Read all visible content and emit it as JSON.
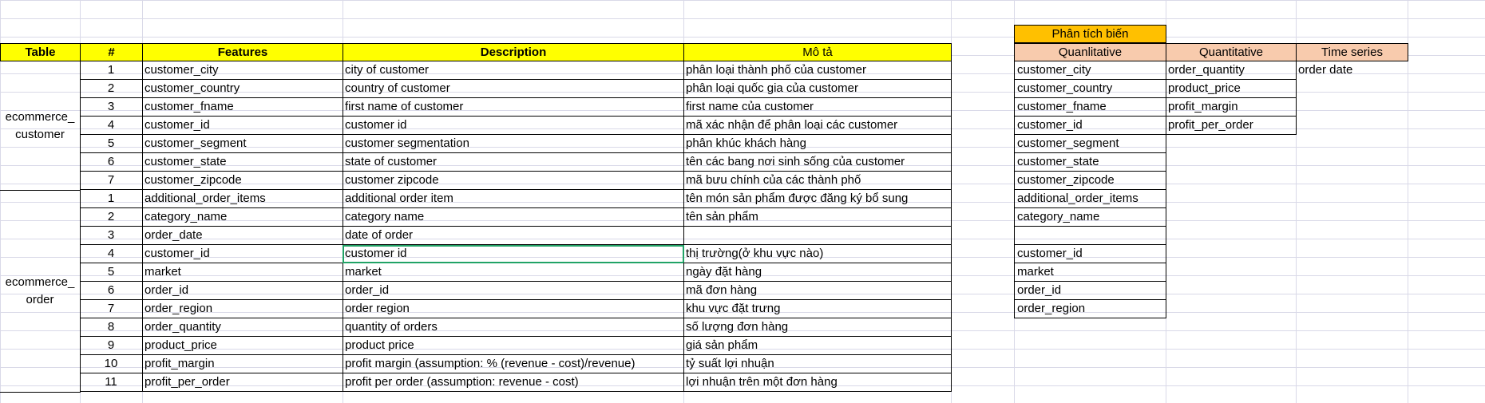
{
  "headers": {
    "table": "Table",
    "num": "#",
    "features": "Features",
    "description": "Description",
    "mota": "Mô tả"
  },
  "groups": {
    "customer": "ecommerce_ customer",
    "order": "ecommerce_ order"
  },
  "customer_rows": [
    {
      "num": "1",
      "feature": "customer_city",
      "desc": "city of customer",
      "mota": "phân loại thành phố của customer"
    },
    {
      "num": "2",
      "feature": "customer_country",
      "desc": "country of customer",
      "mota": "phân loại quốc gia của customer"
    },
    {
      "num": "3",
      "feature": "customer_fname",
      "desc": "first name of customer",
      "mota": "first name của customer"
    },
    {
      "num": "4",
      "feature": "customer_id",
      "desc": "customer id",
      "mota": "mã xác nhận để phân loại các customer"
    },
    {
      "num": "5",
      "feature": "customer_segment",
      "desc": "customer segmentation",
      "mota": "phân khúc khách hàng"
    },
    {
      "num": "6",
      "feature": "customer_state",
      "desc": "state of customer",
      "mota": "tên các bang nơi sinh sống của customer"
    },
    {
      "num": "7",
      "feature": "customer_zipcode",
      "desc": "customer zipcode",
      "mota": "mã bưu chính của các thành phố"
    }
  ],
  "order_rows": [
    {
      "num": "1",
      "feature": "additional_order_items",
      "desc": "additional order item",
      "mota": "tên món sản phẩm  được đăng ký bổ sung"
    },
    {
      "num": "2",
      "feature": "category_name",
      "desc": "category name",
      "mota": "tên sản phẩm"
    },
    {
      "num": "3",
      "feature": "order_date",
      "desc": "date of order",
      "mota": ""
    },
    {
      "num": "4",
      "feature": "customer_id",
      "desc": "customer id",
      "mota": "thị trường(ở khu vực nào)"
    },
    {
      "num": "5",
      "feature": "market",
      "desc": "market",
      "mota": "ngày đặt hàng"
    },
    {
      "num": "6",
      "feature": "order_id",
      "desc": "order_id",
      "mota": "mã đơn hàng"
    },
    {
      "num": "7",
      "feature": "order_region",
      "desc": "order region",
      "mota": "khu vực đặt trưng"
    },
    {
      "num": "8",
      "feature": "order_quantity",
      "desc": "quantity of orders",
      "mota": "số lượng đơn hàng"
    },
    {
      "num": "9",
      "feature": "product_price",
      "desc": "product price",
      "mota": "giá sản phẩm"
    },
    {
      "num": "10",
      "feature": "profit_margin",
      "desc": "profit margin (assumption: % (revenue - cost)/revenue)",
      "mota": "tỷ suất lợi nhuận"
    },
    {
      "num": "11",
      "feature": "profit_per_order",
      "desc": "profit per order (assumption: revenue - cost)",
      "mota": "lợi nhuận trên một đơn hàng"
    }
  ],
  "analysis": {
    "title": "Phân tích biến",
    "qual_header": "Quanlitative",
    "quant_header": "Quantitative",
    "ts_header": "Time series",
    "qualitative": [
      "customer_city",
      "customer_country",
      "customer_fname",
      "customer_id",
      "customer_segment",
      "customer_state",
      "customer_zipcode",
      "additional_order_items",
      "category_name",
      "",
      "customer_id",
      "market",
      "order_id",
      "order_region"
    ],
    "quantitative": [
      "order_quantity",
      "product_price",
      "profit_margin",
      "profit_per_order"
    ],
    "time_series": [
      "order date"
    ]
  },
  "colors": {
    "header_yellow": "#ffff00",
    "title_orange": "#ffc000",
    "subheader_peach": "#f8cbad",
    "selection_green": "#21a366"
  },
  "selected_cell": "customer_id description (row 4 of order table)"
}
